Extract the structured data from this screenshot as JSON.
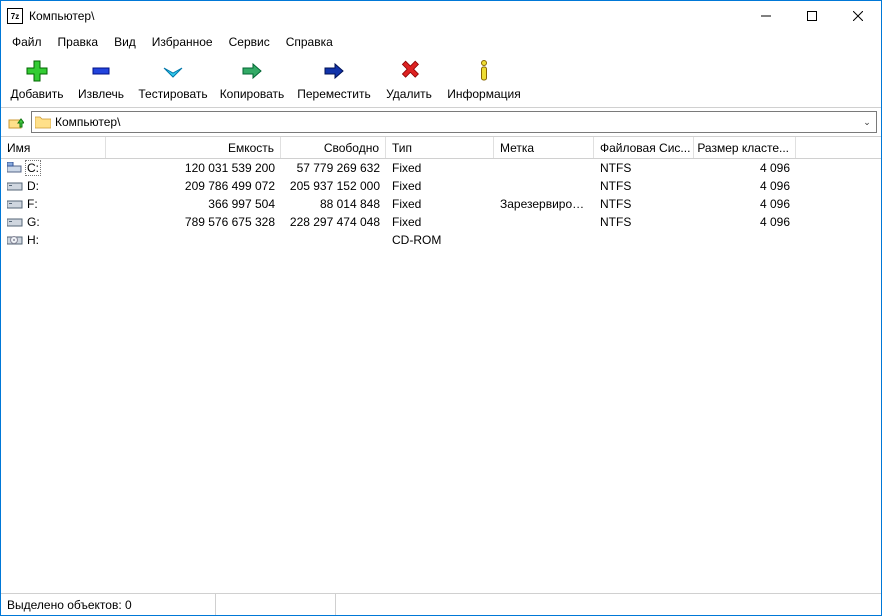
{
  "window": {
    "title": "Компьютер\\",
    "app_abbr": "7z"
  },
  "menu": {
    "file": "Файл",
    "edit": "Правка",
    "view": "Вид",
    "favorites": "Избранное",
    "tools": "Сервис",
    "help": "Справка"
  },
  "toolbar": {
    "add": "Добавить",
    "extract": "Извлечь",
    "test": "Тестировать",
    "copy": "Копировать",
    "move": "Переместить",
    "delete": "Удалить",
    "info": "Информация"
  },
  "address": {
    "path": "Компьютер\\"
  },
  "columns": {
    "name": "Имя",
    "capacity": "Емкость",
    "free": "Свободно",
    "type": "Тип",
    "label": "Метка",
    "filesystem": "Файловая Сис...",
    "cluster": "Размер класте..."
  },
  "drives": [
    {
      "name": "C:",
      "capacity": "120 031 539 200",
      "free": "57 779 269 632",
      "type": "Fixed",
      "label": "",
      "fs": "NTFS",
      "cluster": "4 096",
      "icon": "net"
    },
    {
      "name": "D:",
      "capacity": "209 786 499 072",
      "free": "205 937 152 000",
      "type": "Fixed",
      "label": "",
      "fs": "NTFS",
      "cluster": "4 096",
      "icon": "hdd"
    },
    {
      "name": "F:",
      "capacity": "366 997 504",
      "free": "88 014 848",
      "type": "Fixed",
      "label": "Зарезервиров...",
      "fs": "NTFS",
      "cluster": "4 096",
      "icon": "hdd"
    },
    {
      "name": "G:",
      "capacity": "789 576 675 328",
      "free": "228 297 474 048",
      "type": "Fixed",
      "label": "",
      "fs": "NTFS",
      "cluster": "4 096",
      "icon": "hdd"
    },
    {
      "name": "H:",
      "capacity": "",
      "free": "",
      "type": "CD-ROM",
      "label": "",
      "fs": "",
      "cluster": "",
      "icon": "cd"
    }
  ],
  "status": {
    "selected": "Выделено объектов: 0"
  }
}
